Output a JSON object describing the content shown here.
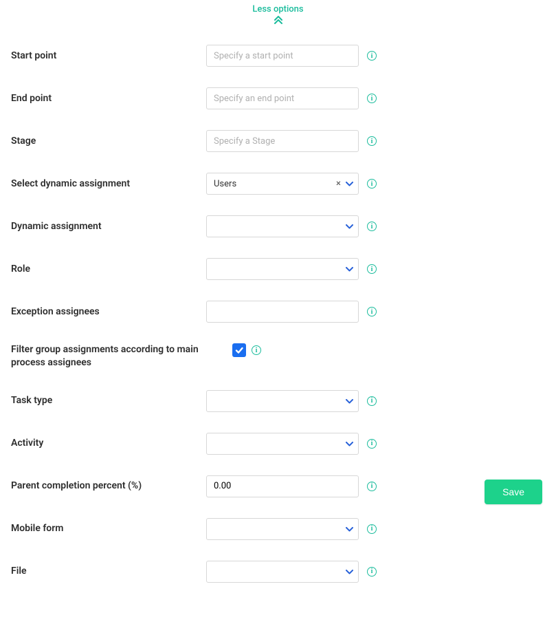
{
  "collapse": {
    "label": "Less options"
  },
  "fields": {
    "start_point": {
      "label": "Start point",
      "placeholder": "Specify a start point",
      "value": ""
    },
    "end_point": {
      "label": "End point",
      "placeholder": "Specify an end point",
      "value": ""
    },
    "stage": {
      "label": "Stage",
      "placeholder": "Specify a Stage",
      "value": ""
    },
    "select_dynamic": {
      "label": "Select dynamic assignment",
      "value": "Users"
    },
    "dynamic": {
      "label": "Dynamic assignment",
      "value": ""
    },
    "role": {
      "label": "Role",
      "value": ""
    },
    "exception": {
      "label": "Exception assignees",
      "value": ""
    },
    "filter_group": {
      "label": "Filter group assignments according to main process assignees",
      "checked": true
    },
    "task_type": {
      "label": "Task type",
      "value": ""
    },
    "activity": {
      "label": "Activity",
      "value": ""
    },
    "parent_pct": {
      "label": "Parent completion percent (%)",
      "value": "0.00"
    },
    "mobile_form": {
      "label": "Mobile form",
      "value": ""
    },
    "file": {
      "label": "File",
      "value": ""
    }
  },
  "actions": {
    "save": "Save"
  }
}
